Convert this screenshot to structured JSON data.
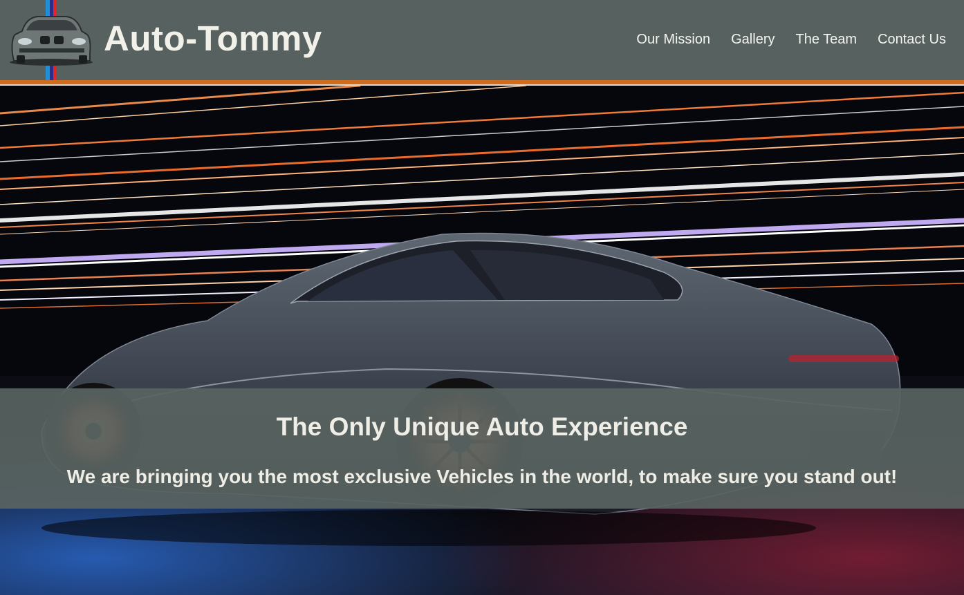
{
  "header": {
    "brand": "Auto-Tommy",
    "logo_icon": "car-front-logo-icon",
    "background_color": "#576260",
    "accent_color": "#d06c1e",
    "nav": [
      {
        "label": "Our Mission"
      },
      {
        "label": "Gallery"
      },
      {
        "label": "The Team"
      },
      {
        "label": "Contact Us"
      }
    ]
  },
  "hero": {
    "image": "sports-car-with-light-streaks",
    "title": "The Only Unique Auto Experience",
    "subtitle": "We are bringing you the most exclusive Vehicles in the world, to make sure you stand out!"
  }
}
